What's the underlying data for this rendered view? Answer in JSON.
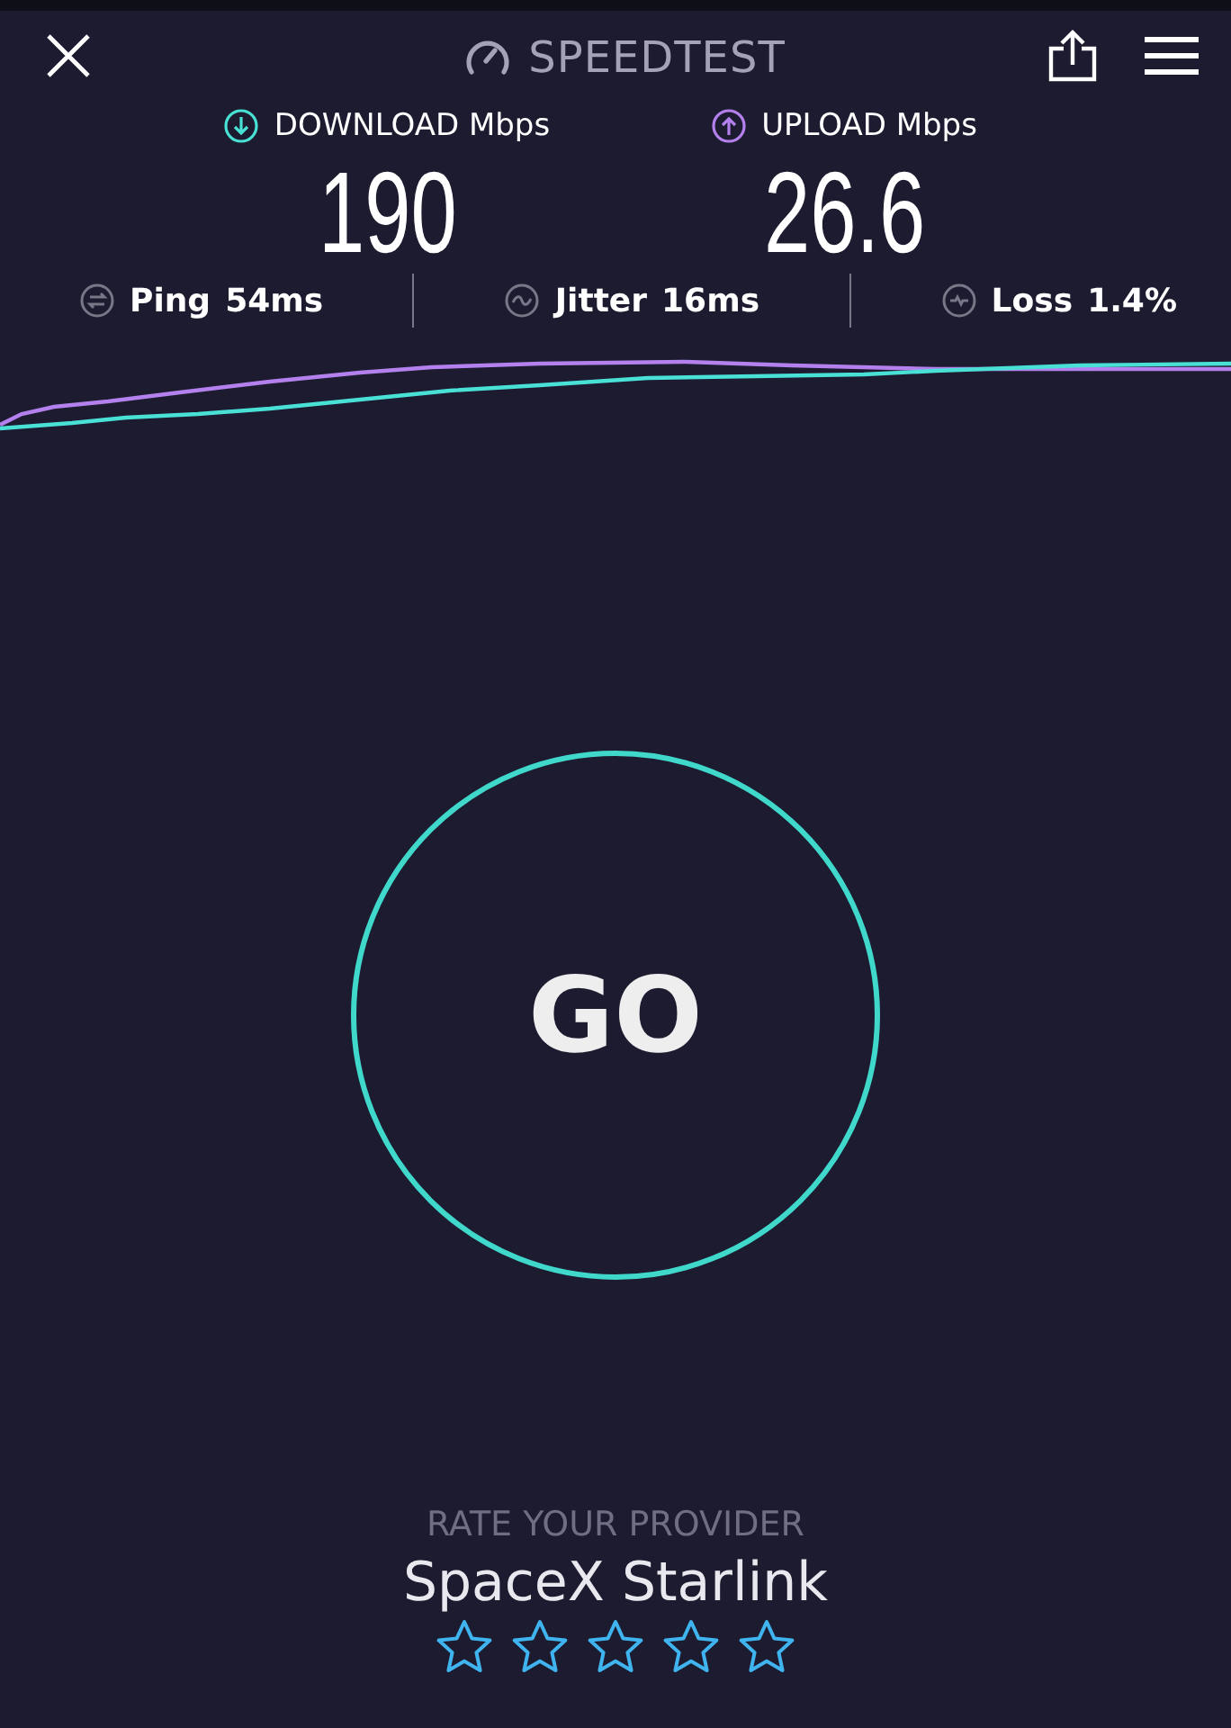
{
  "header": {
    "title": "SPEEDTEST"
  },
  "results": [
    {
      "kind": "download",
      "label": "DOWNLOAD Mbps",
      "value": "190"
    },
    {
      "kind": "upload",
      "label": "UPLOAD Mbps",
      "value": "26.6"
    }
  ],
  "stats": [
    {
      "kind": "ping",
      "label": "Ping",
      "value": "54ms"
    },
    {
      "kind": "jitter",
      "label": "Jitter",
      "value": "16ms"
    },
    {
      "kind": "loss",
      "label": "Loss",
      "value": "1.4%"
    }
  ],
  "go_button": {
    "label": "GO"
  },
  "rating": {
    "prompt": "RATE YOUR PROVIDER",
    "provider": "SpaceX Starlink",
    "stars": 0
  }
}
